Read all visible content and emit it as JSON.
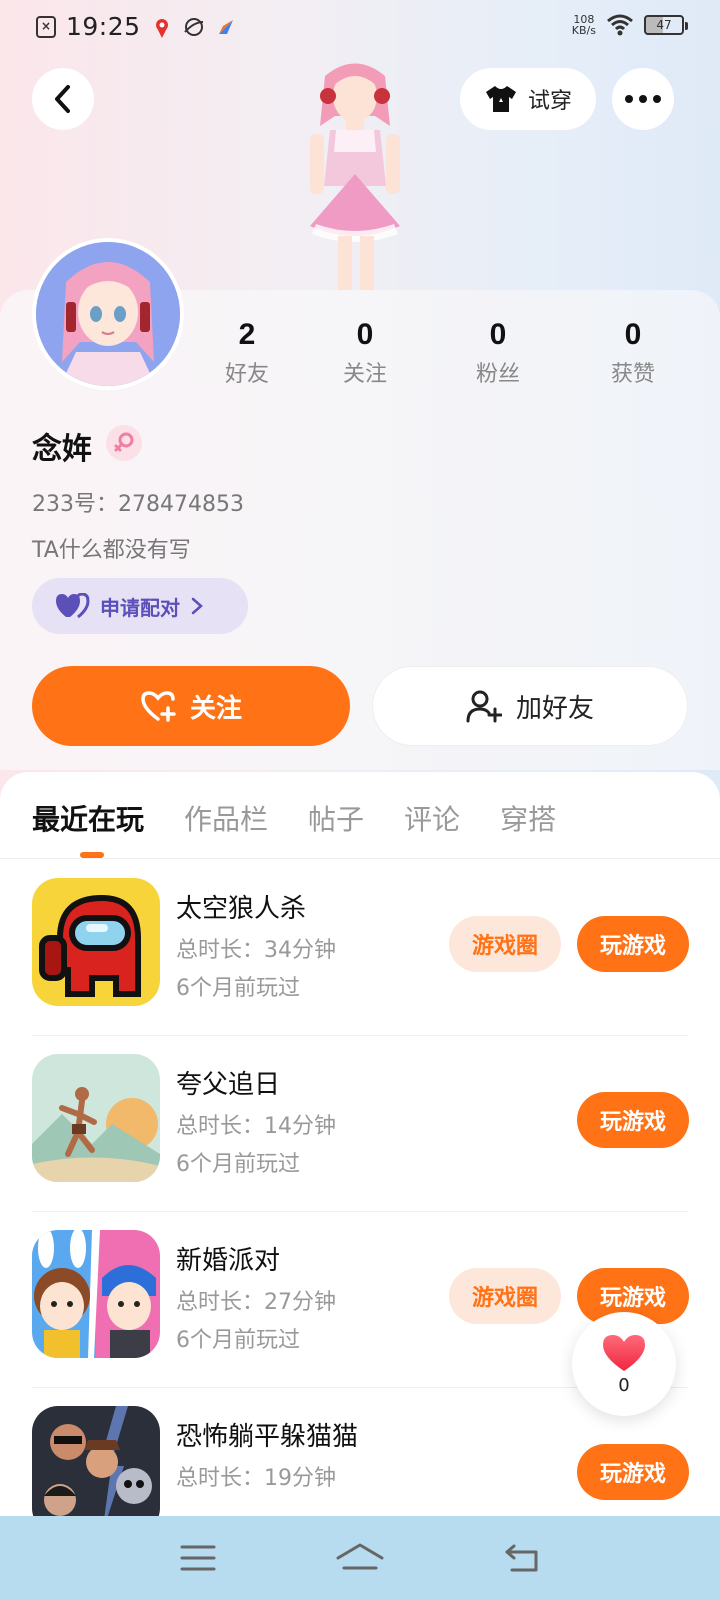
{
  "status_bar": {
    "time": "19:25",
    "net_speed_value": "108",
    "net_speed_unit": "KB/s",
    "battery": "47"
  },
  "header": {
    "try_on_label": "试穿"
  },
  "stats": [
    {
      "value": "2",
      "label": "好友"
    },
    {
      "value": "0",
      "label": "关注"
    },
    {
      "value": "0",
      "label": "粉丝"
    },
    {
      "value": "0",
      "label": "获赞"
    }
  ],
  "profile": {
    "name": "念姩",
    "id_text": "233号：278474853",
    "bio": "TA什么都没有写",
    "pair_label": "申请配对"
  },
  "actions": {
    "follow_label": "关注",
    "add_friend_label": "加好友"
  },
  "tabs": [
    "最近在玩",
    "作品栏",
    "帖子",
    "评论",
    "穿搭"
  ],
  "games": [
    {
      "name": "太空狼人杀",
      "duration": "总时长：34分钟",
      "last_played": "6个月前玩过",
      "has_circle": true
    },
    {
      "name": "夸父追日",
      "duration": "总时长：14分钟",
      "last_played": "6个月前玩过",
      "has_circle": false
    },
    {
      "name": "新婚派对",
      "duration": "总时长：27分钟",
      "last_played": "6个月前玩过",
      "has_circle": true
    },
    {
      "name": "恐怖躺平躲猫猫",
      "duration": "总时长：19分钟",
      "last_played": "",
      "has_circle": false
    }
  ],
  "game_buttons": {
    "circle_label": "游戏圈",
    "play_label": "玩游戏"
  },
  "like_float": {
    "count": "0"
  },
  "colors": {
    "accent": "#ff7316",
    "pair_bg": "#e7e1f5",
    "pair_text": "#5b4fb8",
    "nav_bg": "#b7dcef"
  }
}
